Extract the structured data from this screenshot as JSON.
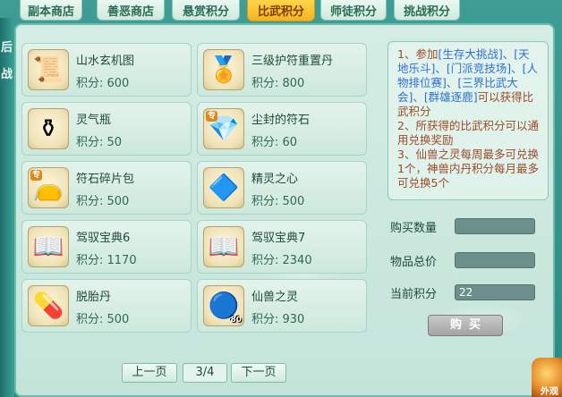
{
  "tabs": [
    {
      "label": "副本商店"
    },
    {
      "label": "善恶商店"
    },
    {
      "label": "悬赏积分"
    },
    {
      "label": "比武积分"
    },
    {
      "label": "师徒积分"
    },
    {
      "label": "挑战积分"
    }
  ],
  "active_tab": "比武积分",
  "left_strip": {
    "chars": [
      "后",
      "战"
    ]
  },
  "items": [
    {
      "name": "山水玄机图",
      "points": "积分: 600",
      "icon": "scroll-icon",
      "glyph": "📜"
    },
    {
      "name": "三级护符重置丹",
      "points": "积分: 800",
      "icon": "gold-amulet-icon",
      "glyph": "🏅"
    },
    {
      "name": "灵气瓶",
      "points": "积分: 50",
      "icon": "vase-icon",
      "glyph": "⚱"
    },
    {
      "name": "尘封的符石",
      "points": "积分: 60",
      "icon": "gem-stone-icon",
      "glyph": "💎",
      "badge": "专"
    },
    {
      "name": "符石碎片包",
      "points": "积分: 500",
      "icon": "pouch-icon",
      "glyph": "👝",
      "badge": "专"
    },
    {
      "name": "精灵之心",
      "points": "积分: 500",
      "icon": "spirit-heart-icon",
      "glyph": "🔷"
    },
    {
      "name": "驾驭宝典6",
      "points": "积分: 1170",
      "icon": "book-icon",
      "glyph": "📖"
    },
    {
      "name": "驾驭宝典7",
      "points": "积分: 2340",
      "icon": "book-icon",
      "glyph": "📖"
    },
    {
      "name": "脱胎丹",
      "points": "积分: 500",
      "icon": "pill-icon",
      "glyph": "💊"
    },
    {
      "name": "仙兽之灵",
      "points": "积分: 930",
      "icon": "blue-orb-icon",
      "glyph": "🔵",
      "count": "80"
    }
  ],
  "info": {
    "line1_prefix": "1、参加",
    "line1_links": "[生存大挑战]、[天地乐斗]、[门派竞技场]、[人物排位赛]、[三界比武大会]、[群雄逐鹿]",
    "line1_suffix": "可以获得比武积分",
    "line2": "2、所获得的比武积分可以通用兑换奖励",
    "line3": "3、仙兽之灵每周最多可兑换1个，神兽内丹积分每月最多可兑换5个"
  },
  "purchase": {
    "qty_label": "购买数量",
    "qty_value": "",
    "total_label": "物品总价",
    "total_value": "",
    "current_label": "当前积分",
    "current_value": "22",
    "buy_label": "购买"
  },
  "pagination": {
    "prev": "上一页",
    "indicator": "3/4",
    "next": "下一页"
  },
  "corner": {
    "text": "外观"
  }
}
